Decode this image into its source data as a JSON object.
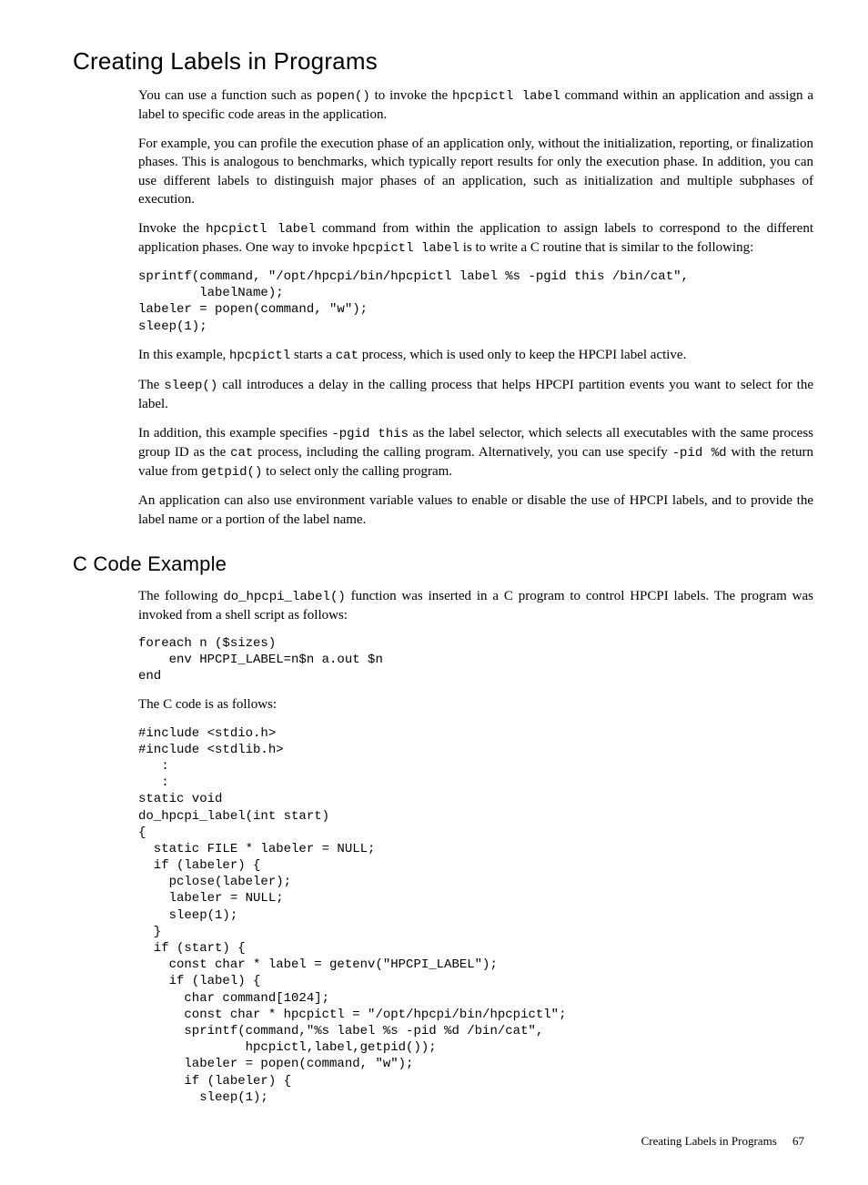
{
  "h1": "Creating Labels in Programs",
  "p1a": "You can use a function such as ",
  "p1b": " to invoke the ",
  "p1c": " command within an application and assign a label to specific code areas in the application.",
  "code_popen": "popen()",
  "code_hpcpictl_label": "hpcpictl label",
  "p2": "For example, you can profile the execution phase of an application only, without the initialization, reporting, or finalization phases. This is analogous to benchmarks, which typically report results for only the execution phase. In addition, you can use different labels to distinguish major phases of an application, such as initialization and multiple subphases of execution.",
  "p3a": "Invoke the ",
  "p3b": " command from within the application to assign labels to correspond to the different application phases. One way to invoke ",
  "p3c": " is to write a C routine that is similar to the following:",
  "pre1": "sprintf(command, \"/opt/hpcpi/bin/hpcpictl label %s -pgid this /bin/cat\",\n        labelName);\nlabeler = popen(command, \"w\");\nsleep(1);",
  "p4a": "In this example, ",
  "p4b": " starts a ",
  "p4c": " process, which is used only to keep the HPCPI label active.",
  "code_hpcpictl": "hpcpictl",
  "code_cat": "cat",
  "p5a": "The ",
  "p5b": " call introduces a delay in the calling process that helps HPCPI partition events you want to select for the label.",
  "code_sleep": "sleep()",
  "p6a": "In addition, this example specifies ",
  "p6b": " as the label selector, which selects all executables with the same process group ID as the ",
  "p6c": " process, including the calling program. Alternatively, you can use specify ",
  "p6d": " with the return value from ",
  "p6e": " to select only the calling program.",
  "code_pgid_this": "-pgid this",
  "code_pid_d": "-pid %d",
  "code_getpid": "getpid()",
  "p7": "An application can also use environment variable values to enable or disable the use of HPCPI labels, and to provide the label name or a portion of the label name.",
  "h2": "C Code Example",
  "p8a": "The following ",
  "p8b": " function was inserted in a C program to control HPCPI labels. The program was invoked from a shell script as follows:",
  "code_dohpcpi": "do_hpcpi_label()",
  "pre2": "foreach n ($sizes)\n    env HPCPI_LABEL=n$n a.out $n\nend",
  "p9": "The C code is as follows:",
  "pre3": "#include <stdio.h>\n#include <stdlib.h>\n   :\n   :\nstatic void\ndo_hpcpi_label(int start)\n{\n  static FILE * labeler = NULL;\n  if (labeler) {\n    pclose(labeler);\n    labeler = NULL;\n    sleep(1);\n  }\n  if (start) {\n    const char * label = getenv(\"HPCPI_LABEL\");\n    if (label) {\n      char command[1024];\n      const char * hpcpictl = \"/opt/hpcpi/bin/hpcpictl\";\n      sprintf(command,\"%s label %s -pid %d /bin/cat\",\n              hpcpictl,label,getpid());\n      labeler = popen(command, \"w\");\n      if (labeler) {\n        sleep(1);",
  "footer_label": "Creating Labels in Programs",
  "footer_page": "67"
}
